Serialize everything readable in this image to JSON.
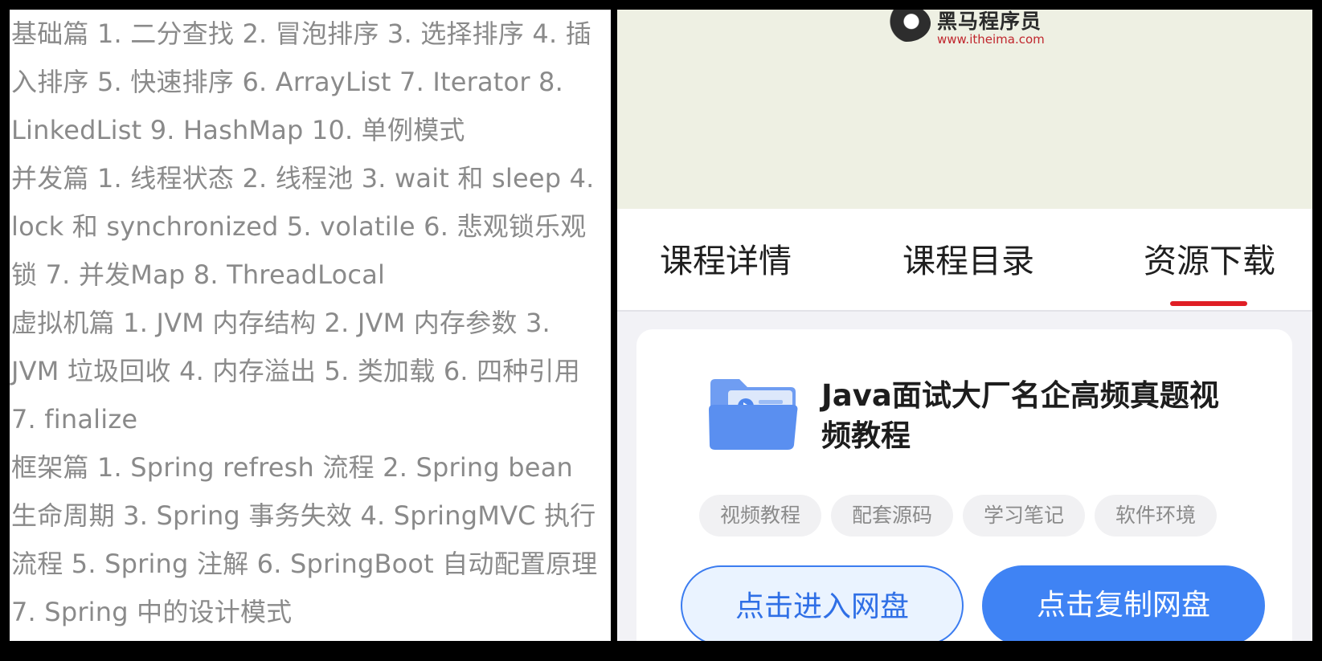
{
  "article": {
    "paragraphs": [
      "基础篇 1. 二分查找 2. 冒泡排序 3. 选择排序 4. 插入排序 5. 快速排序 6. ArrayList 7. Iterator 8. LinkedList 9. HashMap 10. 单例模式",
      "并发篇 1. 线程状态 2. 线程池 3. wait 和 sleep 4. lock 和 synchronized 5. volatile 6. 悲观锁乐观锁 7. 并发Map 8. ThreadLocal",
      "虚拟机篇 1. JVM 内存结构 2. JVM 内存参数 3. JVM 垃圾回收 4. 内存溢出 5. 类加载 6. 四种引用 7. finalize",
      "框架篇 1. Spring refresh 流程 2. Spring bean 生命周期 3. Spring 事务失效 4. SpringMVC 执行流程 5. Spring 注解 6. SpringBoot 自动配置原理 7. Spring 中的设计模式"
    ]
  },
  "banner": {
    "logo_name": "黑马程序员",
    "logo_url": "www.itheima.com"
  },
  "tabs": [
    {
      "label": "课程详情"
    },
    {
      "label": "课程目录"
    },
    {
      "label": "资源下载"
    }
  ],
  "card": {
    "title": "Java面试大厂名企高频真题视频教程",
    "tags": [
      "视频教程",
      "配套源码",
      "学习笔记",
      "软件环境"
    ],
    "open_button": "点击进入网盘",
    "copy_button": "点击复制网盘"
  },
  "colors": {
    "accent_blue": "#3f83f4",
    "tab_indicator": "#e01e25",
    "banner_bg": "#eef0e3"
  }
}
